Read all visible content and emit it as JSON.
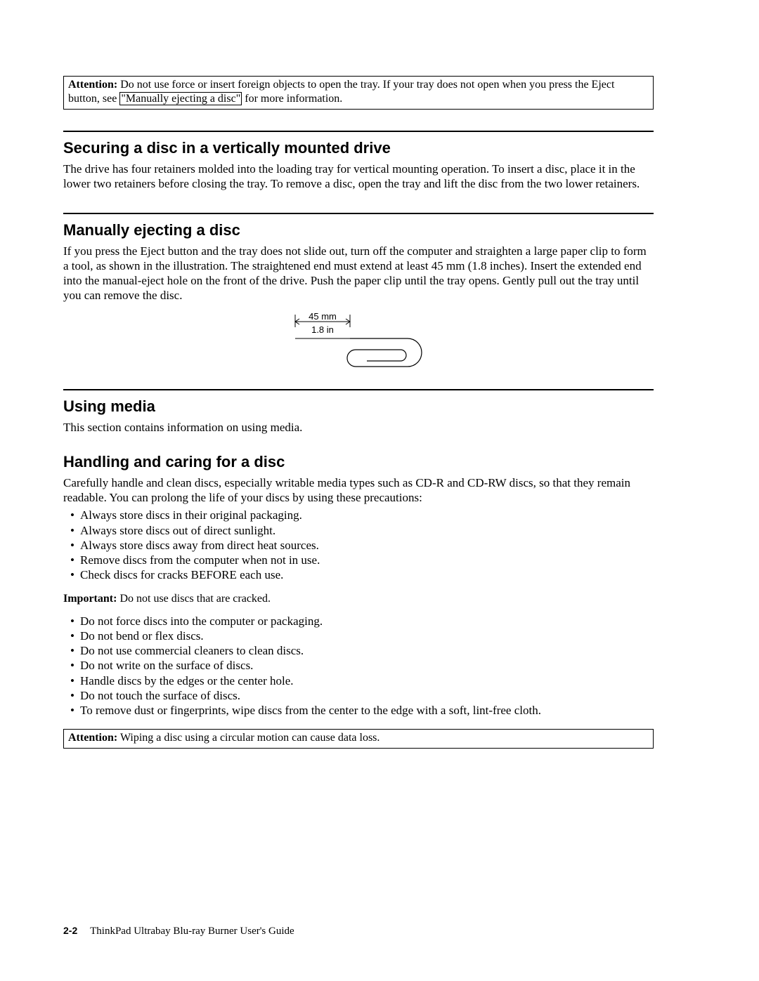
{
  "notice1": {
    "label": "Attention:",
    "text_before_link": "Do not use force or insert foreign objects to open the tray. If your tray does not open when you press the Eject button, see ",
    "link_text": "\"Manually ejecting a disc\"",
    "text_after_link": " for more information."
  },
  "section1": {
    "heading": "Securing a disc in a vertically mounted drive",
    "body": "The drive has four retainers molded into the loading tray for vertical mounting operation. To insert a disc, place it in the lower two retainers before closing the tray. To remove a disc, open the tray and lift the disc from the two lower retainers."
  },
  "section2": {
    "heading": "Manually ejecting a disc",
    "body": "If you press the Eject button and the tray does not slide out, turn off the computer and straighten a large paper clip to form a tool, as shown in the illustration. The straightened end must extend at least 45 mm (1.8 inches). Insert the extended end into the manual-eject hole on the front of the drive. Push the paper clip until the tray opens. Gently pull out the tray until you can remove the disc.",
    "illus": {
      "mm": "45 mm",
      "in": "1.8 in"
    }
  },
  "section3": {
    "heading": "Using media",
    "body": "This section contains information on using media."
  },
  "section4": {
    "heading": "Handling and caring for a disc",
    "body": "Carefully handle and clean discs, especially writable media types such as CD-R and CD-RW discs, so that they remain readable. You can prolong the life of your discs by using these precautions:",
    "bullets_a": [
      "Always store discs in their original packaging.",
      "Always store discs out of direct sunlight.",
      "Always store discs away from direct heat sources.",
      "Remove discs from the computer when not in use.",
      "Check discs for cracks BEFORE each use."
    ],
    "important": {
      "label": "Important:",
      "text": "Do not use discs that are cracked."
    },
    "bullets_b": [
      "Do not force discs into the computer or packaging.",
      "Do not bend or flex discs.",
      "Do not use commercial cleaners to clean discs.",
      "Do not write on the surface of discs.",
      "Handle discs by the edges or the center hole.",
      "Do not touch the surface of discs.",
      "To remove dust or fingerprints, wipe discs from the center to the edge with a soft, lint-free cloth."
    ]
  },
  "notice2": {
    "label": "Attention:",
    "text": "Wiping a disc using a circular motion can cause data loss."
  },
  "footer": {
    "page_num": "2-2",
    "doc_title": "ThinkPad Ultrabay Blu-ray Burner User's Guide"
  }
}
